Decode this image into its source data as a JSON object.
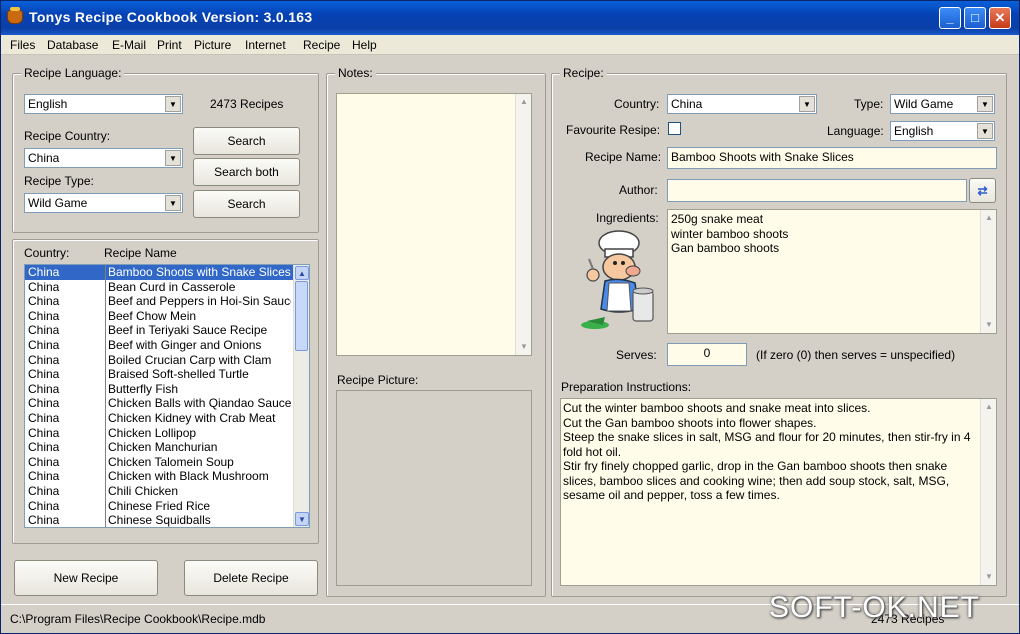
{
  "window": {
    "title": "Tonys Recipe Cookbook Version: 3.0.163"
  },
  "menu": [
    "Files",
    "Database",
    "E-Mail",
    "Print",
    "Picture",
    "Internet",
    "Recipe",
    "Help"
  ],
  "search_panel": {
    "language_label": "Recipe Language:",
    "language_value": "English",
    "recipe_count": "2473 Recipes",
    "country_label": "Recipe Country:",
    "country_value": "China",
    "type_label": "Recipe Type:",
    "type_value": "Wild Game",
    "search_button": "Search",
    "search_both_button": "Search both",
    "search_button_2": "Search"
  },
  "recipe_list": {
    "country_header": "Country:",
    "name_header": "Recipe Name",
    "rows": [
      {
        "country": "China",
        "name": "Bamboo Shoots with Snake Slices"
      },
      {
        "country": "China",
        "name": "Bean Curd in Casserole"
      },
      {
        "country": "China",
        "name": "Beef and Peppers in Hoi-Sin Sauce"
      },
      {
        "country": "China",
        "name": "Beef Chow Mein"
      },
      {
        "country": "China",
        "name": "Beef in Teriyaki Sauce Recipe"
      },
      {
        "country": "China",
        "name": "Beef with Ginger and Onions"
      },
      {
        "country": "China",
        "name": "Boiled Crucian Carp with Clam"
      },
      {
        "country": "China",
        "name": "Braised Soft-shelled Turtle"
      },
      {
        "country": "China",
        "name": "Butterfly Fish"
      },
      {
        "country": "China",
        "name": "Chicken Balls with Qiandao Sauce"
      },
      {
        "country": "China",
        "name": "Chicken Kidney with Crab Meat"
      },
      {
        "country": "China",
        "name": "Chicken Lollipop"
      },
      {
        "country": "China",
        "name": "Chicken Manchurian"
      },
      {
        "country": "China",
        "name": "Chicken Talomein Soup"
      },
      {
        "country": "China",
        "name": "Chicken with Black Mushroom"
      },
      {
        "country": "China",
        "name": "Chili Chicken"
      },
      {
        "country": "China",
        "name": "Chinese Fried Rice"
      },
      {
        "country": "China",
        "name": "Chinese Squidballs"
      }
    ]
  },
  "buttons": {
    "new_recipe": "New Recipe",
    "delete_recipe": "Delete Recipe"
  },
  "notes_panel": {
    "label": "Notes:",
    "picture_label": "Recipe Picture:"
  },
  "recipe_panel": {
    "label": "Recipe:",
    "country_label": "Country:",
    "country_value": "China",
    "type_label": "Type:",
    "type_value": "Wild Game",
    "favourite_label": "Favourite Resipe:",
    "language_label": "Language:",
    "language_value": "English",
    "name_label": "Recipe Name:",
    "name_value": "Bamboo Shoots with Snake Slices",
    "author_label": "Author:",
    "author_value": "",
    "ingredients_label": "Ingredients:",
    "ingredients": "250g snake meat\nwinter bamboo shoots\nGan bamboo shoots",
    "serves_label": "Serves:",
    "serves_value": "0",
    "serves_hint": "(If zero (0) then serves = unspecified)",
    "instructions_label": "Preparation Instructions:",
    "instructions": "Cut the winter bamboo shoots and snake meat into slices.\nCut the Gan bamboo shoots into flower shapes.\nSteep the snake slices in salt, MSG and flour for 20 minutes, then stir-fry in 4\nfold hot oil.\nStir fry finely chopped garlic, drop in the Gan bamboo shoots then snake\nslices, bamboo slices and cooking wine; then add soup stock, salt, MSG,\nsesame oil and pepper, toss a few times."
  },
  "status": {
    "path": "C:\\Program Files\\Recipe Cookbook\\Recipe.mdb",
    "count": "2473 Recipes"
  },
  "watermark": "SOFT-OK.NET"
}
